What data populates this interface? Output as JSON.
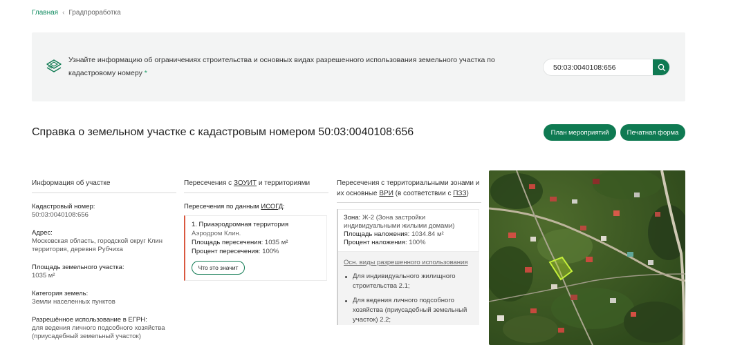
{
  "breadcrumb": {
    "home": "Главная",
    "current": "Градпроработка"
  },
  "banner": {
    "text": "Узнайте информацию об ограничениях строительства и основных видах разрешенного использования земельного участка по кадастровому номеру",
    "required_mark": "*",
    "search_value": "50:03:0040108:656"
  },
  "page": {
    "title": "Справка о земельном участке с кадастровым номером 50:03:0040108:656",
    "plan_button": "План мероприятий",
    "print_button": "Печатная форма"
  },
  "info": {
    "heading": "Информация об участке",
    "fields": [
      {
        "label": "Кадастровый номер:",
        "value": "50:03:0040108:656"
      },
      {
        "label": "Адрес:",
        "value": "Московская область, городской округ Клин территория, деревня Рубчиха"
      },
      {
        "label": "Площадь земельного участка:",
        "value": "1035 м²"
      },
      {
        "label": "Категория земель:",
        "value": "Земли населенных пунктов"
      },
      {
        "label": "Разрешённое использование в ЕГРН:",
        "value": "для ведения личного подсобного хозяйства (приусадебный земельный участок)"
      }
    ]
  },
  "zouit": {
    "heading_pre": "Пересечения с ",
    "heading_abbr": "ЗОУИТ",
    "heading_post": " и территориями",
    "sub_pre": "Пересечения по данным ",
    "sub_abbr": "ИСОГД",
    "sub_post": ":",
    "card": {
      "title": "1. Приаэродромная территория",
      "subtitle": "Аэродром Клин.",
      "area_label": "Площадь пересечения:",
      "area_value": "1035 м²",
      "pct_label": "Процент пересечения:",
      "pct_value": "100%",
      "button": "Что это значит"
    }
  },
  "zones": {
    "heading_pre": "Пересечения с территориальными зонами и их основные ",
    "heading_abbr1": "ВРИ",
    "heading_mid": " (в соответствии с ",
    "heading_abbr2": "ПЗЗ",
    "heading_post": ")",
    "zone_label": "Зона:",
    "zone_value": "Ж-2 (Зона застройки индивидуальными жилыми домами)",
    "area_label": "Площадь наложения:",
    "area_value": "1034.84 м²",
    "pct_label": "Процент наложения:",
    "pct_value": "100%",
    "osn_link": "Осн. виды разрешенного использования",
    "items": [
      "Для индивидуального жилищного строительства 2.1;",
      "Для ведения личного подсобного хозяйства (приусадебный земельный участок) 2.2;"
    ]
  },
  "colors": {
    "accent": "#0f7a52",
    "link": "#0f8a5f",
    "card_border": "#d9583f",
    "banner_bg": "#f3f4f4"
  }
}
